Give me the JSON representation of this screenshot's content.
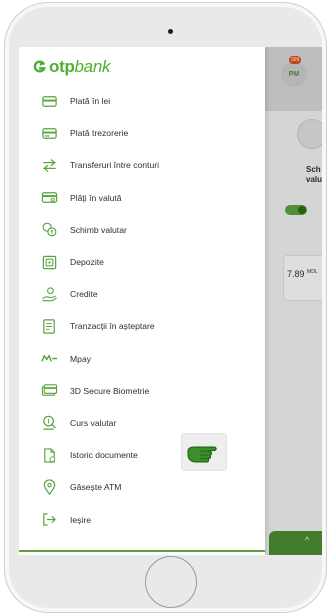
{
  "brand": {
    "name_bold": "otp",
    "name_italic": "bank",
    "color": "#52ae32"
  },
  "background": {
    "avatar_initials": "PM",
    "avatar_badge": "999",
    "label_line1": "Sch",
    "label_line2": "valu",
    "amount": "7.89",
    "currency": "MDL"
  },
  "menu": [
    {
      "label": "Plată în lei",
      "icon": "card-icon"
    },
    {
      "label": "Plată trezorerie",
      "icon": "treasury-card-icon"
    },
    {
      "label": "Transferuri între conturi",
      "icon": "transfer-arrows-icon"
    },
    {
      "label": "Plăți în valută",
      "icon": "currency-card-icon"
    },
    {
      "label": "Schimb valutar",
      "icon": "exchange-coins-icon"
    },
    {
      "label": "Depozite",
      "icon": "deposit-icon"
    },
    {
      "label": "Credite",
      "icon": "credit-hand-icon"
    },
    {
      "label": "Tranzacții în așteptare",
      "icon": "pending-document-icon"
    },
    {
      "label": "Mpay",
      "icon": "mpay-logo-icon"
    },
    {
      "label": "3D Secure Biometrie",
      "icon": "secure-card-icon"
    },
    {
      "label": "Curs valutar",
      "icon": "rate-search-icon"
    },
    {
      "label": "Istoric documente",
      "icon": "document-history-icon"
    },
    {
      "label": "Găsește ATM",
      "icon": "location-pin-icon"
    },
    {
      "label": "Ieșire",
      "icon": "logout-icon"
    }
  ],
  "colors": {
    "accent": "#52ae32",
    "icon": "#5aa33f",
    "text": "#2f2f2f"
  }
}
